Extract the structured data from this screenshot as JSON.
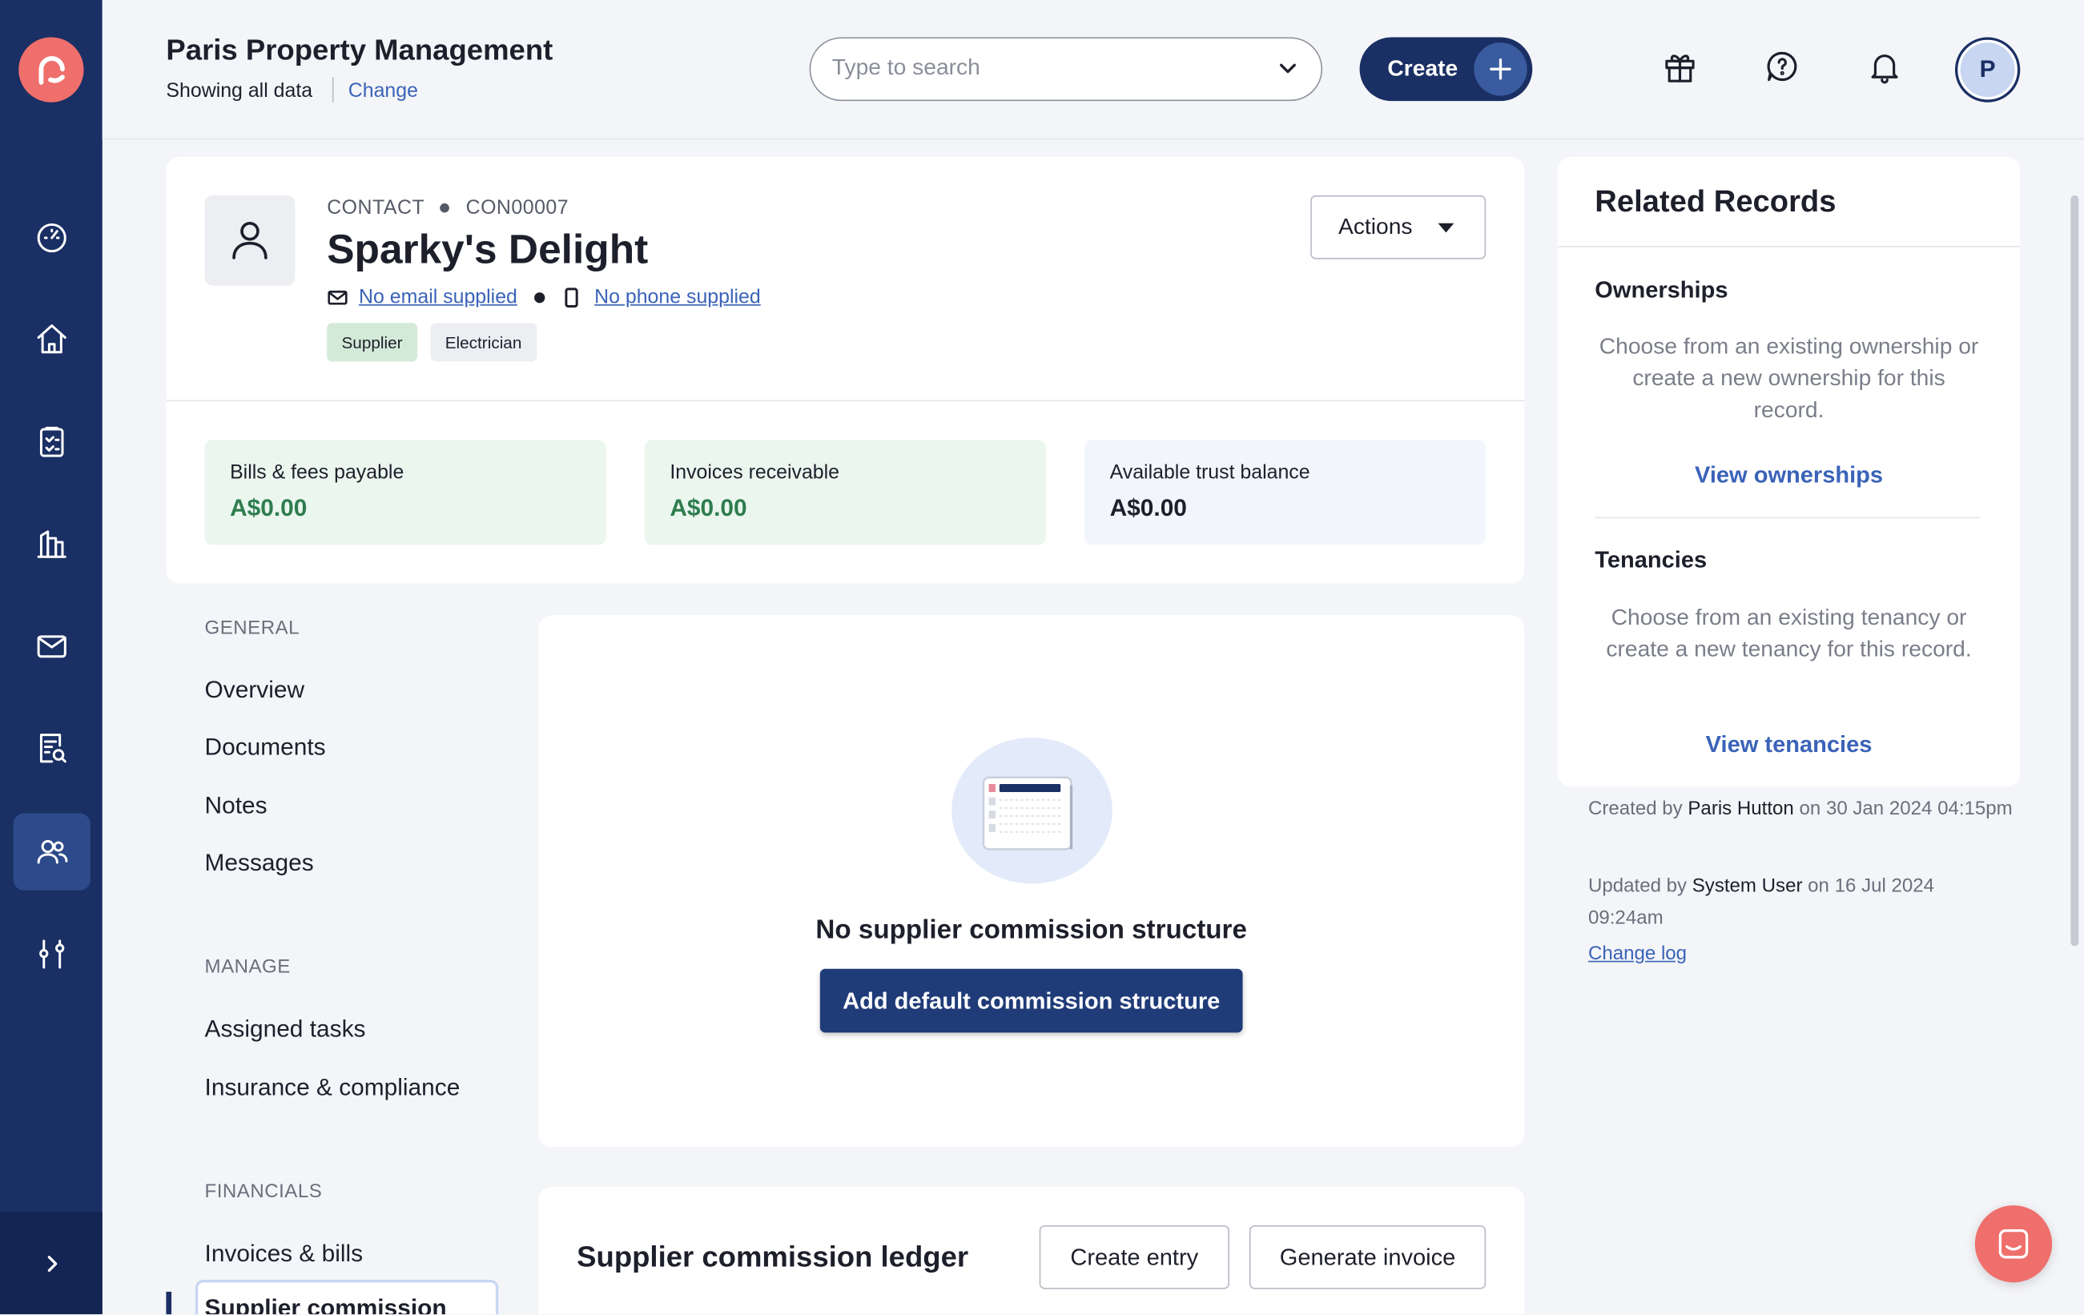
{
  "topbar": {
    "org_name": "Paris Property Management",
    "org_subtitle": "Showing all data",
    "change_label": "Change",
    "search_placeholder": "Type to search",
    "create_label": "Create",
    "avatar_initial": "P"
  },
  "rail": {
    "items": [
      "dashboard-icon",
      "home-icon",
      "clipboard-icon",
      "building-icon",
      "mail-icon",
      "report-search-icon",
      "contacts-icon",
      "settings-sliders-icon"
    ],
    "active": "contacts-icon"
  },
  "contact": {
    "type_label": "CONTACT",
    "id": "CON00007",
    "name": "Sparky's Delight",
    "email": "No email supplied",
    "phone": "No phone supplied",
    "tags": [
      "Supplier",
      "Electrician"
    ],
    "actions_label": "Actions"
  },
  "stats": [
    {
      "label": "Bills & fees payable",
      "value": "A$0.00"
    },
    {
      "label": "Invoices receivable",
      "value": "A$0.00"
    },
    {
      "label": "Available trust balance",
      "value": "A$0.00"
    }
  ],
  "subnav": {
    "general_heading": "GENERAL",
    "general": [
      "Overview",
      "Documents",
      "Notes",
      "Messages"
    ],
    "manage_heading": "MANAGE",
    "manage": [
      "Assigned tasks",
      "Insurance & compliance"
    ],
    "financials_heading": "FINANCIALS",
    "financials": [
      "Invoices & bills",
      "Supplier commission"
    ]
  },
  "commission": {
    "empty_title": "No supplier commission structure",
    "add_button": "Add default commission structure"
  },
  "ledger": {
    "title": "Supplier commission ledger",
    "create_entry": "Create entry",
    "generate_invoice": "Generate invoice"
  },
  "related": {
    "title": "Related Records",
    "ownerships_heading": "Ownerships",
    "ownerships_text": "Choose from an existing ownership or create a new ownership for this record.",
    "ownerships_link": "View ownerships",
    "tenancies_heading": "Tenancies",
    "tenancies_text": "Choose from an existing tenancy or create a new tenancy for this record.",
    "tenancies_link": "View tenancies"
  },
  "meta": {
    "created_prefix": "Created by",
    "created_by": "Paris Hutton",
    "created_on": "on 30 Jan 2024 04:15pm",
    "updated_prefix": "Updated by",
    "updated_by": "System User",
    "updated_on": "on 16 Jul 2024 09:24am",
    "change_log": "Change log"
  },
  "colors": {
    "rail": "#1a2f63",
    "brand": "#ef6f6c",
    "link": "#3a63b8",
    "positive": "#2e7d4f"
  }
}
